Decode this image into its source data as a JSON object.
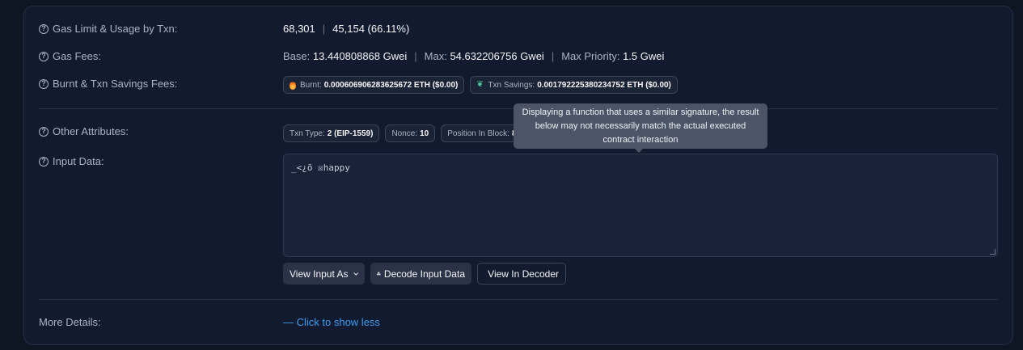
{
  "gas_limit": {
    "label": "Gas Limit & Usage by Txn:",
    "limit": "68,301",
    "separator": "|",
    "usage": "45,154 (66.11%)"
  },
  "gas_fees": {
    "label": "Gas Fees:",
    "base_label": "Base:",
    "base_value": "13.440808868 Gwei",
    "sep": "|",
    "max_label": "Max:",
    "max_value": "54.632206756 Gwei",
    "max_priority_label": "Max Priority:",
    "max_priority_value": "1.5 Gwei"
  },
  "burnt": {
    "label": "Burnt & Txn Savings Fees:",
    "burnt_label": "Burnt:",
    "burnt_value": "0.000606906283625672 ETH ($0.00)",
    "savings_label": "Txn Savings:",
    "savings_value": "0.001792225380234752 ETH ($0.00)"
  },
  "other": {
    "label": "Other Attributes:",
    "txn_type_label": "Txn Type:",
    "txn_type_value": "2 (EIP-1559)",
    "nonce_label": "Nonce:",
    "nonce_value": "10",
    "position_label": "Position In Block:",
    "position_value": "8"
  },
  "input": {
    "label": "Input Data:",
    "value": "_<¿õ ☒happy",
    "view_as": "View Input As",
    "decode": "Decode Input Data",
    "view_decoder": "View In Decoder"
  },
  "tooltip": "Displaying a function that uses a similar signature, the result below may not necessarily match the actual executed contract interaction",
  "more_details": {
    "label": "More Details:",
    "link": "— Click to show less"
  },
  "help_icon": "?",
  "colors": {
    "background": "#0e1523",
    "card": "#111a2e",
    "link": "#3d9cf0",
    "muted": "#aab4c3"
  }
}
